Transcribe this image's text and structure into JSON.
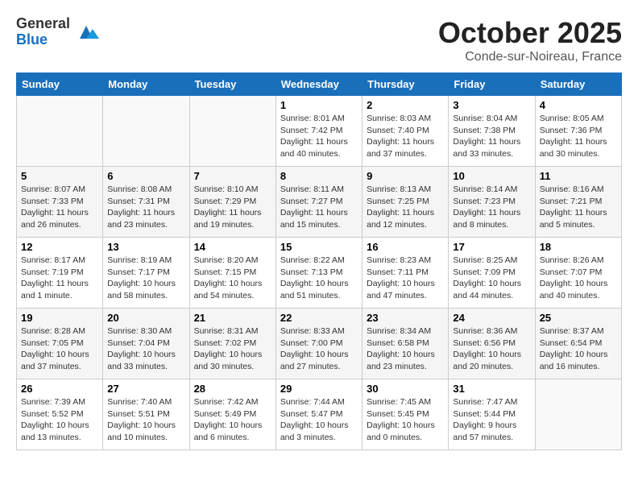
{
  "header": {
    "logo_line1": "General",
    "logo_line2": "Blue",
    "month": "October 2025",
    "location": "Conde-sur-Noireau, France"
  },
  "weekdays": [
    "Sunday",
    "Monday",
    "Tuesday",
    "Wednesday",
    "Thursday",
    "Friday",
    "Saturday"
  ],
  "weeks": [
    [
      {
        "day": "",
        "info": ""
      },
      {
        "day": "",
        "info": ""
      },
      {
        "day": "",
        "info": ""
      },
      {
        "day": "1",
        "info": "Sunrise: 8:01 AM\nSunset: 7:42 PM\nDaylight: 11 hours\nand 40 minutes."
      },
      {
        "day": "2",
        "info": "Sunrise: 8:03 AM\nSunset: 7:40 PM\nDaylight: 11 hours\nand 37 minutes."
      },
      {
        "day": "3",
        "info": "Sunrise: 8:04 AM\nSunset: 7:38 PM\nDaylight: 11 hours\nand 33 minutes."
      },
      {
        "day": "4",
        "info": "Sunrise: 8:05 AM\nSunset: 7:36 PM\nDaylight: 11 hours\nand 30 minutes."
      }
    ],
    [
      {
        "day": "5",
        "info": "Sunrise: 8:07 AM\nSunset: 7:33 PM\nDaylight: 11 hours\nand 26 minutes."
      },
      {
        "day": "6",
        "info": "Sunrise: 8:08 AM\nSunset: 7:31 PM\nDaylight: 11 hours\nand 23 minutes."
      },
      {
        "day": "7",
        "info": "Sunrise: 8:10 AM\nSunset: 7:29 PM\nDaylight: 11 hours\nand 19 minutes."
      },
      {
        "day": "8",
        "info": "Sunrise: 8:11 AM\nSunset: 7:27 PM\nDaylight: 11 hours\nand 15 minutes."
      },
      {
        "day": "9",
        "info": "Sunrise: 8:13 AM\nSunset: 7:25 PM\nDaylight: 11 hours\nand 12 minutes."
      },
      {
        "day": "10",
        "info": "Sunrise: 8:14 AM\nSunset: 7:23 PM\nDaylight: 11 hours\nand 8 minutes."
      },
      {
        "day": "11",
        "info": "Sunrise: 8:16 AM\nSunset: 7:21 PM\nDaylight: 11 hours\nand 5 minutes."
      }
    ],
    [
      {
        "day": "12",
        "info": "Sunrise: 8:17 AM\nSunset: 7:19 PM\nDaylight: 11 hours\nand 1 minute."
      },
      {
        "day": "13",
        "info": "Sunrise: 8:19 AM\nSunset: 7:17 PM\nDaylight: 10 hours\nand 58 minutes."
      },
      {
        "day": "14",
        "info": "Sunrise: 8:20 AM\nSunset: 7:15 PM\nDaylight: 10 hours\nand 54 minutes."
      },
      {
        "day": "15",
        "info": "Sunrise: 8:22 AM\nSunset: 7:13 PM\nDaylight: 10 hours\nand 51 minutes."
      },
      {
        "day": "16",
        "info": "Sunrise: 8:23 AM\nSunset: 7:11 PM\nDaylight: 10 hours\nand 47 minutes."
      },
      {
        "day": "17",
        "info": "Sunrise: 8:25 AM\nSunset: 7:09 PM\nDaylight: 10 hours\nand 44 minutes."
      },
      {
        "day": "18",
        "info": "Sunrise: 8:26 AM\nSunset: 7:07 PM\nDaylight: 10 hours\nand 40 minutes."
      }
    ],
    [
      {
        "day": "19",
        "info": "Sunrise: 8:28 AM\nSunset: 7:05 PM\nDaylight: 10 hours\nand 37 minutes."
      },
      {
        "day": "20",
        "info": "Sunrise: 8:30 AM\nSunset: 7:04 PM\nDaylight: 10 hours\nand 33 minutes."
      },
      {
        "day": "21",
        "info": "Sunrise: 8:31 AM\nSunset: 7:02 PM\nDaylight: 10 hours\nand 30 minutes."
      },
      {
        "day": "22",
        "info": "Sunrise: 8:33 AM\nSunset: 7:00 PM\nDaylight: 10 hours\nand 27 minutes."
      },
      {
        "day": "23",
        "info": "Sunrise: 8:34 AM\nSunset: 6:58 PM\nDaylight: 10 hours\nand 23 minutes."
      },
      {
        "day": "24",
        "info": "Sunrise: 8:36 AM\nSunset: 6:56 PM\nDaylight: 10 hours\nand 20 minutes."
      },
      {
        "day": "25",
        "info": "Sunrise: 8:37 AM\nSunset: 6:54 PM\nDaylight: 10 hours\nand 16 minutes."
      }
    ],
    [
      {
        "day": "26",
        "info": "Sunrise: 7:39 AM\nSunset: 5:52 PM\nDaylight: 10 hours\nand 13 minutes."
      },
      {
        "day": "27",
        "info": "Sunrise: 7:40 AM\nSunset: 5:51 PM\nDaylight: 10 hours\nand 10 minutes."
      },
      {
        "day": "28",
        "info": "Sunrise: 7:42 AM\nSunset: 5:49 PM\nDaylight: 10 hours\nand 6 minutes."
      },
      {
        "day": "29",
        "info": "Sunrise: 7:44 AM\nSunset: 5:47 PM\nDaylight: 10 hours\nand 3 minutes."
      },
      {
        "day": "30",
        "info": "Sunrise: 7:45 AM\nSunset: 5:45 PM\nDaylight: 10 hours\nand 0 minutes."
      },
      {
        "day": "31",
        "info": "Sunrise: 7:47 AM\nSunset: 5:44 PM\nDaylight: 9 hours\nand 57 minutes."
      },
      {
        "day": "",
        "info": ""
      }
    ]
  ]
}
